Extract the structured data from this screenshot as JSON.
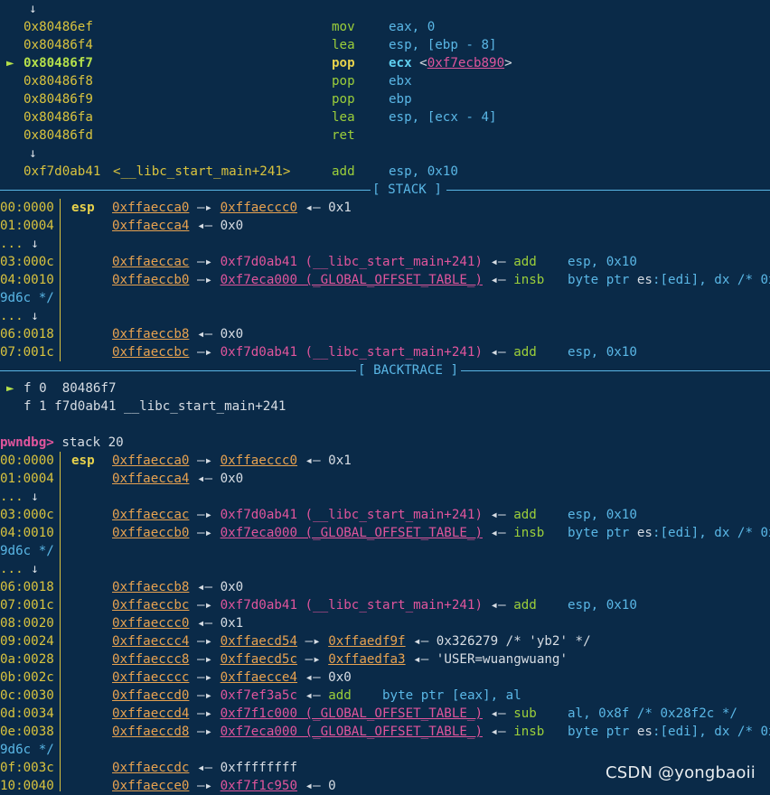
{
  "disasm": {
    "arrow_top": "↓",
    "rows": [
      {
        "addr": "0x80486ef",
        "mnem": "mov",
        "ops": "eax, 0"
      },
      {
        "addr": "0x80486f4",
        "mnem": "lea",
        "ops": "esp, [ebp - 8]"
      },
      {
        "addr": "0x80486f7",
        "mnem": "pop",
        "ops": "ecx <0xf7ecb890>"
      },
      {
        "addr": "0x80486f8",
        "mnem": "pop",
        "ops": "ebx"
      },
      {
        "addr": "0x80486f9",
        "mnem": "pop",
        "ops": "ebp"
      },
      {
        "addr": "0x80486fa",
        "mnem": "lea",
        "ops": "esp, [ecx - 4]"
      },
      {
        "addr": "0x80486fd",
        "mnem": "ret",
        "ops": ""
      }
    ],
    "cursor": "►",
    "arrow_mid": "↓",
    "tail_addr": "0xf7d0ab41",
    "tail_sym": "<__libc_start_main+241>",
    "tail_mnem": "add",
    "tail_ops": "esp, 0x10"
  },
  "sections": {
    "stack": "[ STACK ]",
    "backtrace": "[ BACKTRACE ]"
  },
  "backtrace": {
    "f0": "f 0  80486f7",
    "f1": "f 1 f7d0ab41 __libc_start_main+241"
  },
  "prompt": {
    "label": "pwndbg>",
    "command": "stack 20"
  },
  "watermark": "CSDN @yongbaoii",
  "colors": {
    "background": "#0a2a48",
    "address_yellow": "#d9c33e",
    "mnemonic_green": "#9ccf3a",
    "operand_blue": "#5ab7e6",
    "link_orange": "#e7a250",
    "libc_pink": "#e0559c"
  }
}
